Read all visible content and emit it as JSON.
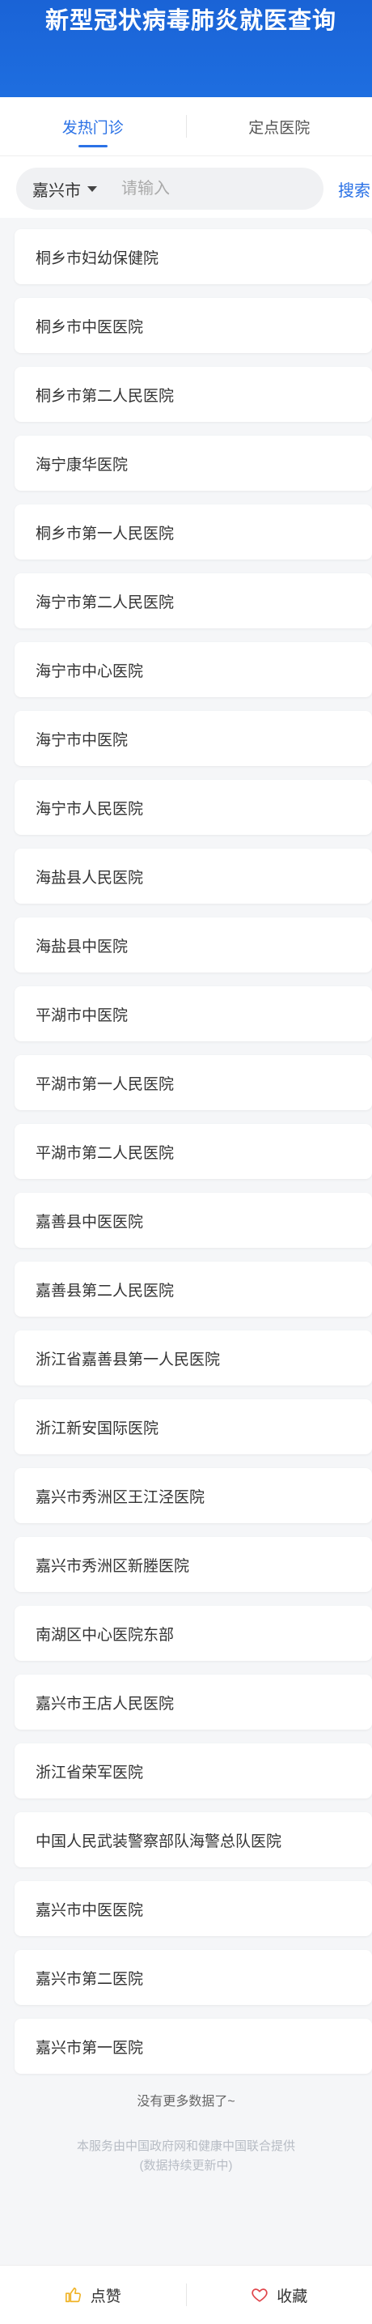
{
  "header": {
    "title": "新型冠状病毒肺炎就医查询"
  },
  "tabs": [
    {
      "label": "发热门诊",
      "active": true
    },
    {
      "label": "定点医院",
      "active": false
    }
  ],
  "search": {
    "city": "嘉兴市",
    "placeholder": "请输入",
    "button_label": "搜索"
  },
  "hospitals": [
    "桐乡市妇幼保健院",
    "桐乡市中医医院",
    "桐乡市第二人民医院",
    "海宁康华医院",
    "桐乡市第一人民医院",
    "海宁市第二人民医院",
    "海宁市中心医院",
    "海宁市中医院",
    "海宁市人民医院",
    "海盐县人民医院",
    "海盐县中医院",
    "平湖市中医院",
    "平湖市第一人民医院",
    "平湖市第二人民医院",
    "嘉善县中医医院",
    "嘉善县第二人民医院",
    "浙江省嘉善县第一人民医院",
    "浙江新安国际医院",
    "嘉兴市秀洲区王江泾医院",
    "嘉兴市秀洲区新塍医院",
    "南湖区中心医院东部",
    "嘉兴市王店人民医院",
    "浙江省荣军医院",
    "中国人民武装警察部队海警总队医院",
    "嘉兴市中医医院",
    "嘉兴市第二医院",
    "嘉兴市第一医院"
  ],
  "no_more": "没有更多数据了~",
  "footer": {
    "line1": "本服务由中国政府网和健康中国联合提供",
    "line2": "(数据持续更新中)"
  },
  "bottom_bar": {
    "like_label": "点赞",
    "collect_label": "收藏",
    "like_icon": "thumbs-up-icon",
    "collect_icon": "heart-icon"
  },
  "colors": {
    "brand": "#1e6ee0",
    "accent": "#2b72e6",
    "like_icon": "#f0b429",
    "collect_icon": "#e0454a"
  }
}
